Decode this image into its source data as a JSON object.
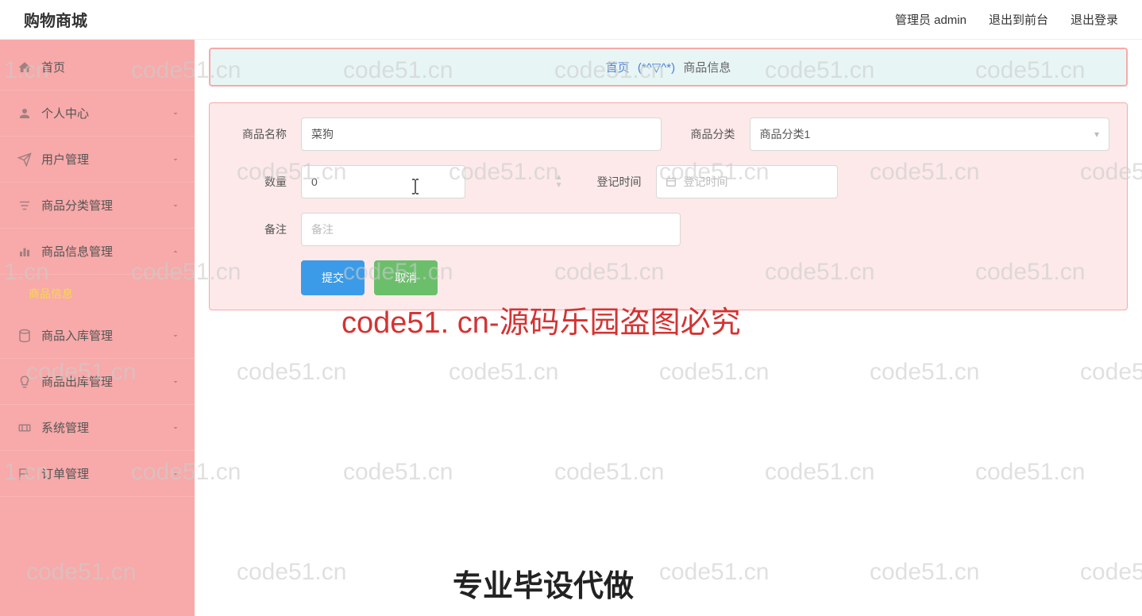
{
  "header": {
    "brand": "购物商城",
    "user_label": "管理员 admin",
    "exit_front": "退出到前台",
    "logout": "退出登录"
  },
  "sidebar": {
    "items": [
      {
        "key": "home",
        "label": "首页",
        "icon": "home",
        "expandable": false
      },
      {
        "key": "profile",
        "label": "个人中心",
        "icon": "user",
        "expandable": true
      },
      {
        "key": "user-mgmt",
        "label": "用户管理",
        "icon": "send",
        "expandable": true
      },
      {
        "key": "category-mgmt",
        "label": "商品分类管理",
        "icon": "filter",
        "expandable": true
      },
      {
        "key": "product-info-mgmt",
        "label": "商品信息管理",
        "icon": "bar-chart",
        "expandable": true,
        "expanded": true
      },
      {
        "key": "stock-in-mgmt",
        "label": "商品入库管理",
        "icon": "database",
        "expandable": true
      },
      {
        "key": "stock-out-mgmt",
        "label": "商品出库管理",
        "icon": "bulb",
        "expandable": true
      },
      {
        "key": "system-mgmt",
        "label": "系统管理",
        "icon": "ticket",
        "expandable": true
      },
      {
        "key": "order-mgmt",
        "label": "订单管理",
        "icon": "flag",
        "expandable": true
      }
    ],
    "sub_product_info": "商品信息"
  },
  "breadcrumb": {
    "home": "首页",
    "emoji": "(*^▽^*)",
    "current": "商品信息"
  },
  "form": {
    "name_label": "商品名称",
    "name_value": "菜狗",
    "category_label": "商品分类",
    "category_value": "商品分类1",
    "qty_label": "数量",
    "qty_value": "0",
    "time_label": "登记时间",
    "time_placeholder": "登记时间",
    "remark_label": "备注",
    "remark_placeholder": "备注",
    "submit": "提交",
    "cancel": "取消"
  },
  "watermark": {
    "big": "code51. cn-源码乐园盗图必究",
    "bottom": "专业毕设代做",
    "small": "code51.cn",
    "small_left": "1.cn"
  }
}
